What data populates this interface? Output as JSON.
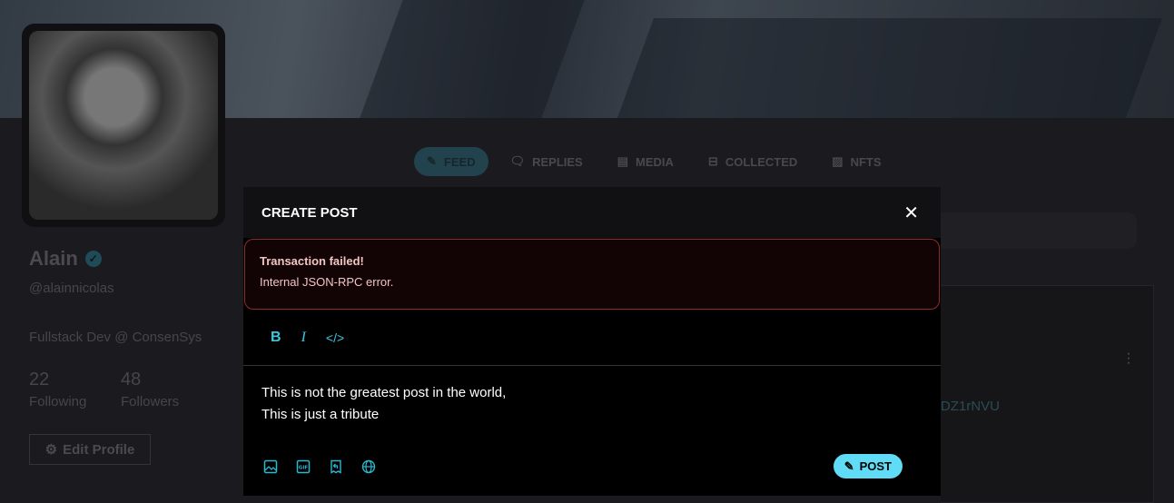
{
  "profile": {
    "name": "Alain",
    "handle": "@alainnicolas",
    "bio": "Fullstack Dev @ ConsenSys",
    "following_count": "22",
    "following_label": "Following",
    "followers_count": "48",
    "followers_label": "Followers",
    "edit_label": "Edit Profile"
  },
  "tabs": [
    {
      "label": "FEED",
      "icon": "pencil-square-icon",
      "active": true
    },
    {
      "label": "REPLIES",
      "icon": "chat-bubbles-icon"
    },
    {
      "label": "MEDIA",
      "icon": "film-icon"
    },
    {
      "label": "COLLECTED",
      "icon": "collection-icon"
    },
    {
      "label": "NFTS",
      "icon": "image-icon"
    }
  ],
  "feed_card": {
    "address_fragment": "DZ1rNVU"
  },
  "modal": {
    "title": "CREATE POST",
    "error_title": "Transaction failed!",
    "error_detail": "Internal JSON-RPC error.",
    "toolbar": {
      "bold": "B",
      "italic": "I",
      "code": "</>"
    },
    "text_line1": "This is not the greatest post in the world,",
    "text_line2": "This is just a tribute",
    "post_label": "POST",
    "attachments": [
      "image-icon",
      "gif-icon",
      "collect-icon",
      "globe-icon"
    ]
  },
  "colors": {
    "accent": "#61dcf6",
    "error_border": "#8e2b2b"
  }
}
